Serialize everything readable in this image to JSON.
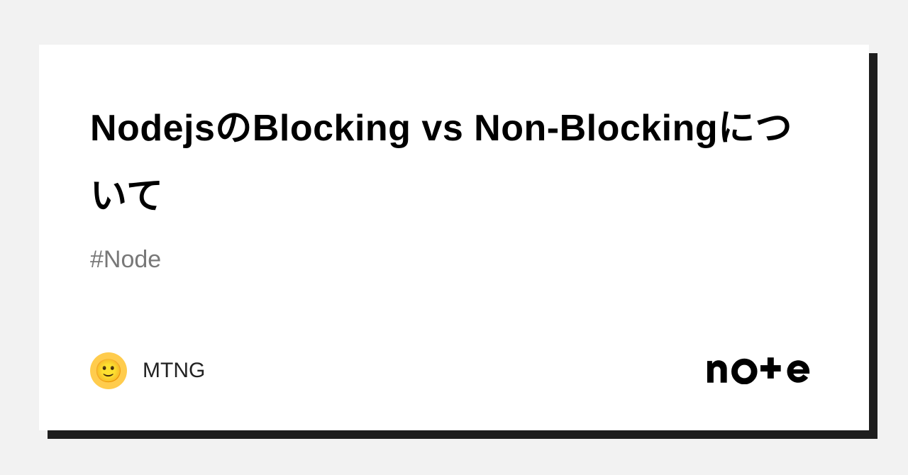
{
  "card": {
    "title": "NodejsのBlocking vs Non-Blockingについて",
    "hashtag": "#Node",
    "author": {
      "name": "MTNG",
      "avatar_emoji": "🙂"
    },
    "platform": "note"
  }
}
